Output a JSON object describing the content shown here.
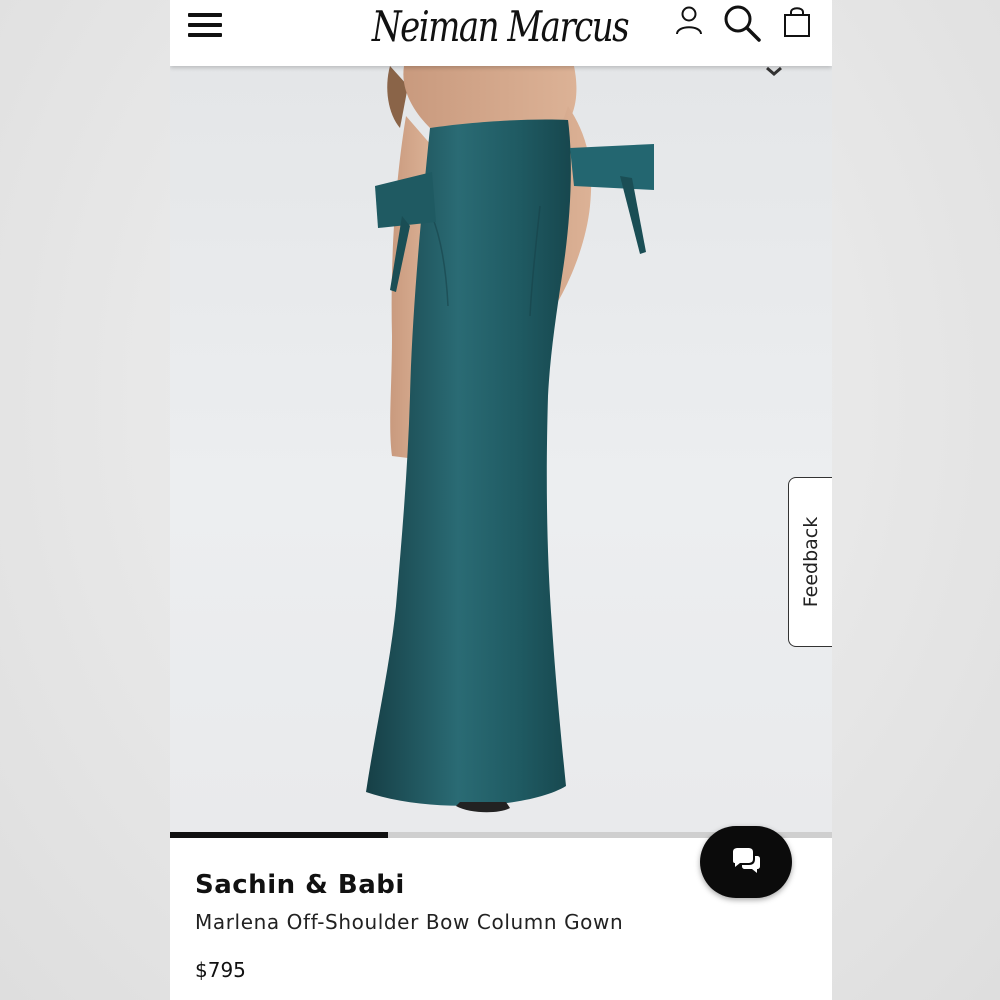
{
  "header": {
    "logo_text": "Neiman Marcus",
    "icons": [
      "menu-icon",
      "account-icon",
      "search-icon",
      "shopping-bag-icon"
    ]
  },
  "gallery": {
    "current_image": 1,
    "progress": 0.33
  },
  "feedback": {
    "label": "Feedback"
  },
  "chat": {
    "icon": "chat-bubbles-icon"
  },
  "product": {
    "brand": "Sachin & Babi",
    "name": "Marlena Off-Shoulder Bow Column Gown",
    "price": "$795"
  },
  "colors": {
    "dress": "#1f5a62",
    "brand_black": "#111111",
    "background": "#ebebeb"
  }
}
